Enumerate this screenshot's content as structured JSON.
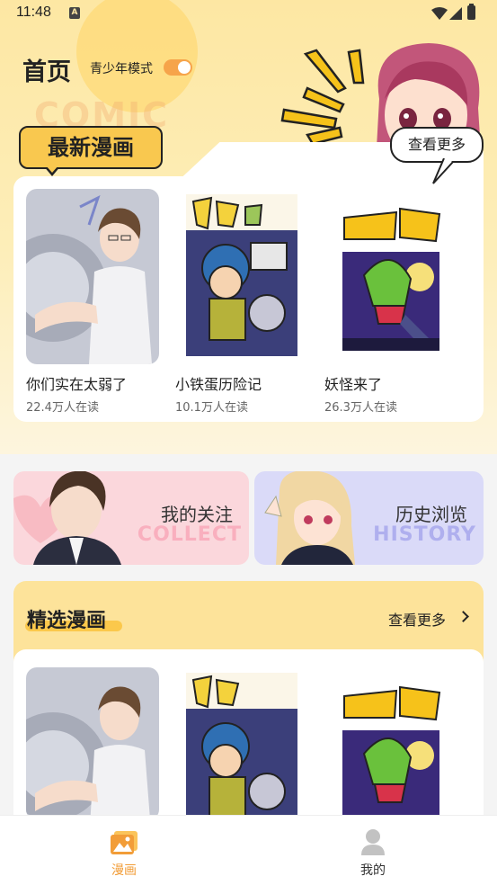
{
  "status_bar": {
    "time": "11:48",
    "notification_icon": "A"
  },
  "header": {
    "title": "首页",
    "teen_mode_label": "青少年模式",
    "teen_mode_on": true
  },
  "latest": {
    "tag": "最新漫画",
    "more_label": "查看更多",
    "items": [
      {
        "title": "你们实在太弱了",
        "readers": "22.4万人在读"
      },
      {
        "title": "小铁蛋历险记",
        "readers": "10.1万人在读"
      },
      {
        "title": "妖怪来了",
        "readers": "26.3万人在读"
      }
    ]
  },
  "quick_links": [
    {
      "label": "我的关注",
      "ghost": "COLLECT"
    },
    {
      "label": "历史浏览",
      "ghost": "HISTORY"
    }
  ],
  "featured": {
    "title": "精选漫画",
    "more_label": "查看更多"
  },
  "tabbar": {
    "items": [
      {
        "label": "漫画",
        "active": true,
        "icon": "comic-icon"
      },
      {
        "label": "我的",
        "active": false,
        "icon": "user-icon"
      }
    ]
  },
  "colors": {
    "accent": "#f6a44a",
    "tag_yellow": "#f9c84f",
    "featured_bg": "#fde39a",
    "active_tab": "#f29d38"
  }
}
